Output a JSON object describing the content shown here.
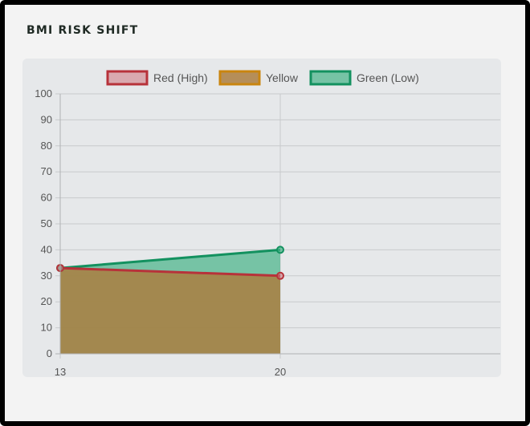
{
  "card": {
    "title": "BMI RISK SHIFT"
  },
  "chart_data": {
    "type": "area",
    "x": [
      13,
      20
    ],
    "ylim": [
      0,
      100
    ],
    "yticks": [
      0,
      10,
      20,
      30,
      40,
      50,
      60,
      70,
      80,
      90,
      100
    ],
    "xticks": [
      "13",
      "20"
    ],
    "grid": true,
    "legend_position": "top",
    "series": [
      {
        "name": "Red (High)",
        "values": [
          33,
          30
        ],
        "color": "#b7323a",
        "fill": "rgba(205,116,126,0.55)"
      },
      {
        "name": "Yellow",
        "values": [
          33,
          30
        ],
        "color": "#c9850f",
        "fill": "rgba(172,126,63,0.85)"
      },
      {
        "name": "Green (Low)",
        "values": [
          33,
          40
        ],
        "color": "#13915f",
        "fill": "rgba(70,180,135,0.70)"
      }
    ]
  }
}
